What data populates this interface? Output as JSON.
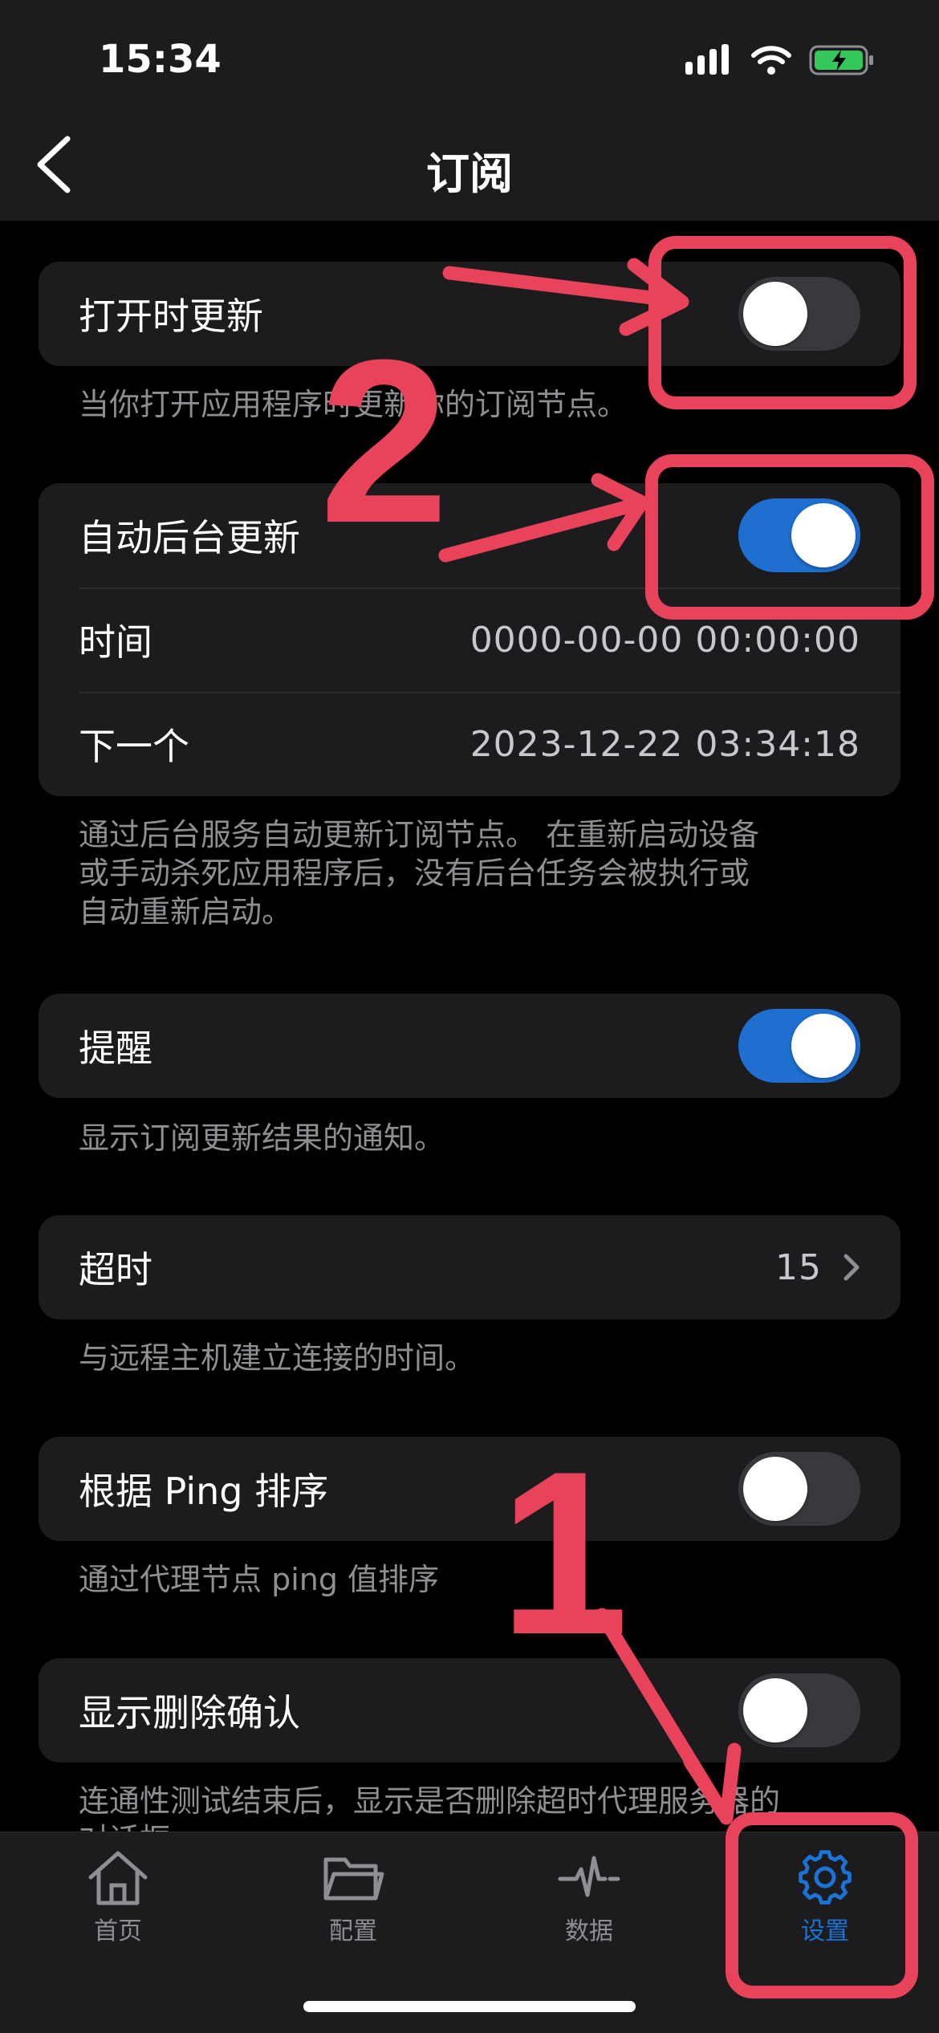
{
  "status": {
    "time": "15:34"
  },
  "nav": {
    "title": "订阅"
  },
  "groups": {
    "open_update": {
      "label": "打开时更新",
      "toggle": "off",
      "footnote": "当你打开应用程序时更新你的订阅节点。"
    },
    "auto_bg": {
      "label": "自动后台更新",
      "toggle": "on",
      "time_label": "时间",
      "time_value": "0000-00-00 00:00:00",
      "next_label": "下一个",
      "next_value": "2023-12-22 03:34:18",
      "footnote": [
        "通过后台服务自动更新订阅节点。 在重新启动设备",
        "或手动杀死应用程序后，没有后台任务会被执行或",
        "自动重新启动。"
      ]
    },
    "remind": {
      "label": "提醒",
      "toggle": "on",
      "footnote": "显示订阅更新结果的通知。"
    },
    "timeout": {
      "label": "超时",
      "value": "15",
      "footnote": "与远程主机建立连接的时间。"
    },
    "ping_sort": {
      "label": "根据 Ping 排序",
      "toggle": "off",
      "footnote": "通过代理节点 ping 值排序"
    },
    "delete_confirm": {
      "label": "显示删除确认",
      "toggle": "off",
      "footnote": [
        "连通性测试结束后，显示是否删除超时代理服务器的",
        "对话框"
      ]
    }
  },
  "tabbar": {
    "tabs": [
      {
        "label": "首页",
        "icon": "home-icon",
        "active": false
      },
      {
        "label": "配置",
        "icon": "folder-icon",
        "active": false
      },
      {
        "label": "数据",
        "icon": "pulse-icon",
        "active": false
      },
      {
        "label": "设置",
        "icon": "gear-icon",
        "active": true
      }
    ]
  },
  "annotations": {
    "num1": "1",
    "num2": "2",
    "color": "#e8435a"
  },
  "colors": {
    "accent": "#1e6fd0",
    "background": "#000000",
    "card": "#1c1c1e"
  }
}
